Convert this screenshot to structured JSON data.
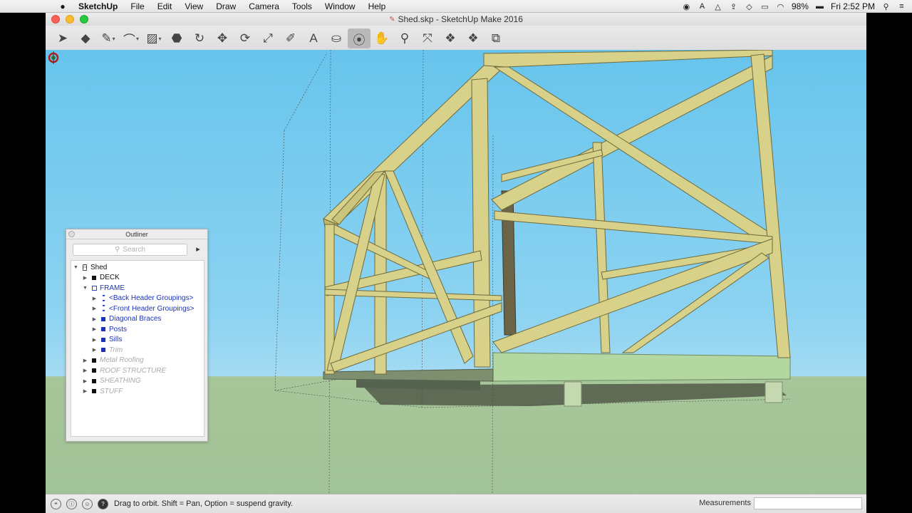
{
  "menubar": {
    "apple_icon": "apple-icon",
    "app_name": "SketchUp",
    "items": [
      "File",
      "Edit",
      "View",
      "Draw",
      "Camera",
      "Tools",
      "Window",
      "Help"
    ],
    "battery": "98%",
    "clock": "Fri 2:52 PM",
    "status_icons": [
      "record-icon",
      "adobe-icon",
      "drive-icon",
      "upload-icon",
      "dropbox-icon",
      "airplay-icon",
      "wifi-icon",
      "battery-icon",
      "search-icon",
      "list-icon"
    ]
  },
  "window": {
    "title": "Shed.skp - SketchUp Make 2016"
  },
  "toolbar": {
    "tools": [
      {
        "name": "select-tool",
        "glyph": "➤"
      },
      {
        "name": "eraser-tool",
        "glyph": "◆"
      },
      {
        "name": "line-tool",
        "glyph": "✎"
      },
      {
        "name": "arc-tool",
        "glyph": "⌒"
      },
      {
        "name": "shapes-tool",
        "glyph": "▨"
      },
      {
        "name": "push-pull-tool",
        "glyph": "⬣"
      },
      {
        "name": "offset-tool",
        "glyph": "↻"
      },
      {
        "name": "move-tool",
        "glyph": "✥"
      },
      {
        "name": "rotate-tool",
        "glyph": "⟳"
      },
      {
        "name": "scale-tool",
        "glyph": "⤢"
      },
      {
        "name": "tape-measure-tool",
        "glyph": "✐"
      },
      {
        "name": "text-tool",
        "glyph": "A"
      },
      {
        "name": "paint-bucket-tool",
        "glyph": "⛀"
      },
      {
        "name": "orbit-tool",
        "glyph": "⦿"
      },
      {
        "name": "pan-tool",
        "glyph": "✋"
      },
      {
        "name": "zoom-tool",
        "glyph": "⚲"
      },
      {
        "name": "zoom-extents-tool",
        "glyph": "⤧"
      },
      {
        "name": "3d-warehouse-tool",
        "glyph": "❖"
      },
      {
        "name": "extension-warehouse-tool",
        "glyph": "❖"
      },
      {
        "name": "layout-tool",
        "glyph": "⧉"
      }
    ]
  },
  "outliner": {
    "title": "Outliner",
    "search_placeholder": "Search",
    "rows": [
      {
        "indent": 0,
        "tri": "▼",
        "icon": "model",
        "label": "Shed",
        "style": "normal"
      },
      {
        "indent": 1,
        "tri": "▶",
        "icon": "group",
        "label": "DECK",
        "style": "normal"
      },
      {
        "indent": 1,
        "tri": "▼",
        "icon": "group-open",
        "label": "FRAME",
        "style": "blue"
      },
      {
        "indent": 2,
        "tri": "▶",
        "icon": "component",
        "label": "<Back Header Groupings>",
        "style": "blue"
      },
      {
        "indent": 2,
        "tri": "▶",
        "icon": "component",
        "label": "<Front Header Groupings>",
        "style": "blue"
      },
      {
        "indent": 2,
        "tri": "▶",
        "icon": "group-blue",
        "label": "Diagonal Braces",
        "style": "blue"
      },
      {
        "indent": 2,
        "tri": "▶",
        "icon": "group-blue",
        "label": "Posts",
        "style": "blue"
      },
      {
        "indent": 2,
        "tri": "▶",
        "icon": "group-blue",
        "label": "Sills",
        "style": "blue"
      },
      {
        "indent": 2,
        "tri": "▶",
        "icon": "group-blue",
        "label": "Trim",
        "style": "hidden"
      },
      {
        "indent": 1,
        "tri": "▶",
        "icon": "group",
        "label": "Metal Roofing",
        "style": "hidden"
      },
      {
        "indent": 1,
        "tri": "▶",
        "icon": "group",
        "label": "ROOF STRUCTURE",
        "style": "hidden"
      },
      {
        "indent": 1,
        "tri": "▶",
        "icon": "group",
        "label": "SHEATHING",
        "style": "hidden"
      },
      {
        "indent": 1,
        "tri": "▶",
        "icon": "group",
        "label": "STUFF",
        "style": "hidden"
      }
    ]
  },
  "statusbar": {
    "hint": "Drag to orbit. Shift = Pan, Option = suspend gravity.",
    "measurements_label": "Measurements",
    "measurements_value": ""
  },
  "colors": {
    "sky": "#67c4ec",
    "ground": "#a2c397",
    "lumber": "#d8d18a",
    "selection_blue": "#1c33b8"
  }
}
